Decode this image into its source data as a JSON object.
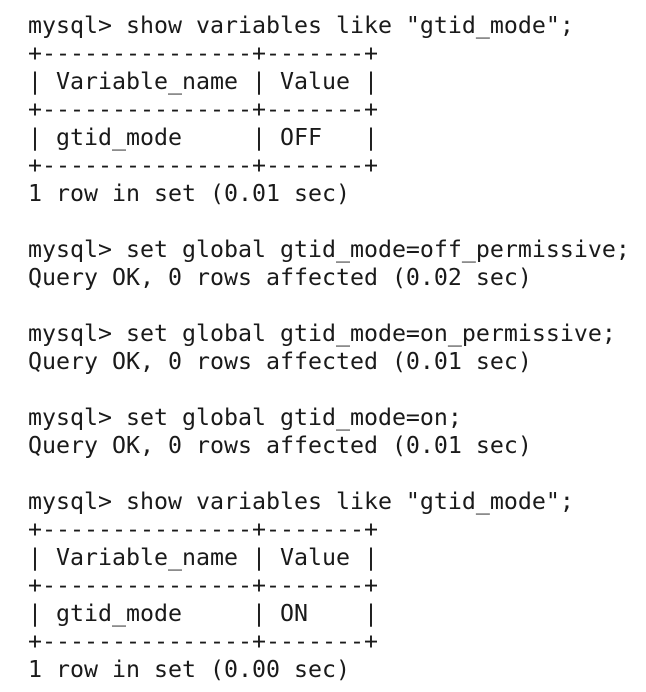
{
  "lines": [
    "mysql> show variables like \"gtid_mode\";",
    "+---------------+-------+",
    "| Variable_name | Value |",
    "+---------------+-------+",
    "| gtid_mode     | OFF   |",
    "+---------------+-------+",
    "1 row in set (0.01 sec)",
    "",
    "mysql> set global gtid_mode=off_permissive;",
    "Query OK, 0 rows affected (0.02 sec)",
    "",
    "mysql> set global gtid_mode=on_permissive;",
    "Query OK, 0 rows affected (0.01 sec)",
    "",
    "mysql> set global gtid_mode=on;",
    "Query OK, 0 rows affected (0.01 sec)",
    "",
    "mysql> show variables like \"gtid_mode\";",
    "+---------------+-------+",
    "| Variable_name | Value |",
    "+---------------+-------+",
    "| gtid_mode     | ON    |",
    "+---------------+-------+",
    "1 row in set (0.00 sec)"
  ]
}
